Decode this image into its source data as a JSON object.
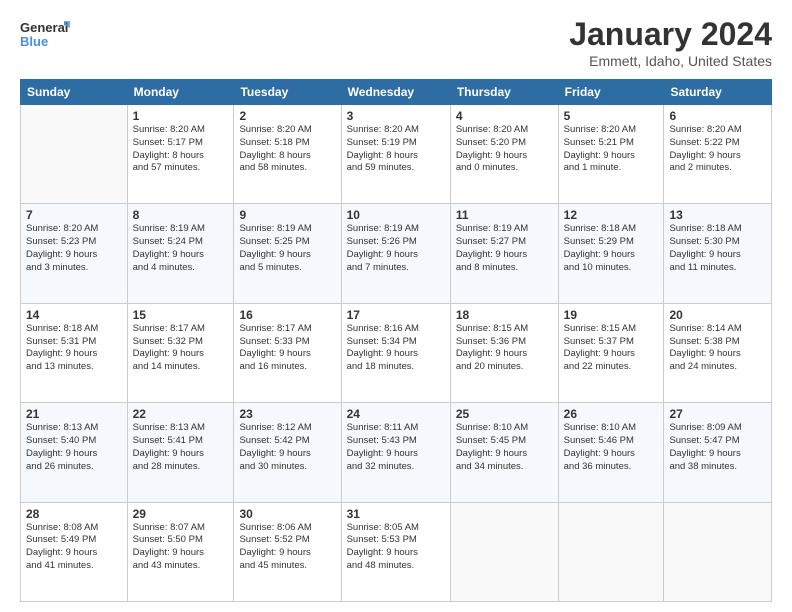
{
  "header": {
    "logo_line1": "General",
    "logo_line2": "Blue",
    "month": "January 2024",
    "location": "Emmett, Idaho, United States"
  },
  "days_of_week": [
    "Sunday",
    "Monday",
    "Tuesday",
    "Wednesday",
    "Thursday",
    "Friday",
    "Saturday"
  ],
  "weeks": [
    [
      {
        "day": "",
        "info": ""
      },
      {
        "day": "1",
        "info": "Sunrise: 8:20 AM\nSunset: 5:17 PM\nDaylight: 8 hours\nand 57 minutes."
      },
      {
        "day": "2",
        "info": "Sunrise: 8:20 AM\nSunset: 5:18 PM\nDaylight: 8 hours\nand 58 minutes."
      },
      {
        "day": "3",
        "info": "Sunrise: 8:20 AM\nSunset: 5:19 PM\nDaylight: 8 hours\nand 59 minutes."
      },
      {
        "day": "4",
        "info": "Sunrise: 8:20 AM\nSunset: 5:20 PM\nDaylight: 9 hours\nand 0 minutes."
      },
      {
        "day": "5",
        "info": "Sunrise: 8:20 AM\nSunset: 5:21 PM\nDaylight: 9 hours\nand 1 minute."
      },
      {
        "day": "6",
        "info": "Sunrise: 8:20 AM\nSunset: 5:22 PM\nDaylight: 9 hours\nand 2 minutes."
      }
    ],
    [
      {
        "day": "7",
        "info": "Sunrise: 8:20 AM\nSunset: 5:23 PM\nDaylight: 9 hours\nand 3 minutes."
      },
      {
        "day": "8",
        "info": "Sunrise: 8:19 AM\nSunset: 5:24 PM\nDaylight: 9 hours\nand 4 minutes."
      },
      {
        "day": "9",
        "info": "Sunrise: 8:19 AM\nSunset: 5:25 PM\nDaylight: 9 hours\nand 5 minutes."
      },
      {
        "day": "10",
        "info": "Sunrise: 8:19 AM\nSunset: 5:26 PM\nDaylight: 9 hours\nand 7 minutes."
      },
      {
        "day": "11",
        "info": "Sunrise: 8:19 AM\nSunset: 5:27 PM\nDaylight: 9 hours\nand 8 minutes."
      },
      {
        "day": "12",
        "info": "Sunrise: 8:18 AM\nSunset: 5:29 PM\nDaylight: 9 hours\nand 10 minutes."
      },
      {
        "day": "13",
        "info": "Sunrise: 8:18 AM\nSunset: 5:30 PM\nDaylight: 9 hours\nand 11 minutes."
      }
    ],
    [
      {
        "day": "14",
        "info": "Sunrise: 8:18 AM\nSunset: 5:31 PM\nDaylight: 9 hours\nand 13 minutes."
      },
      {
        "day": "15",
        "info": "Sunrise: 8:17 AM\nSunset: 5:32 PM\nDaylight: 9 hours\nand 14 minutes."
      },
      {
        "day": "16",
        "info": "Sunrise: 8:17 AM\nSunset: 5:33 PM\nDaylight: 9 hours\nand 16 minutes."
      },
      {
        "day": "17",
        "info": "Sunrise: 8:16 AM\nSunset: 5:34 PM\nDaylight: 9 hours\nand 18 minutes."
      },
      {
        "day": "18",
        "info": "Sunrise: 8:15 AM\nSunset: 5:36 PM\nDaylight: 9 hours\nand 20 minutes."
      },
      {
        "day": "19",
        "info": "Sunrise: 8:15 AM\nSunset: 5:37 PM\nDaylight: 9 hours\nand 22 minutes."
      },
      {
        "day": "20",
        "info": "Sunrise: 8:14 AM\nSunset: 5:38 PM\nDaylight: 9 hours\nand 24 minutes."
      }
    ],
    [
      {
        "day": "21",
        "info": "Sunrise: 8:13 AM\nSunset: 5:40 PM\nDaylight: 9 hours\nand 26 minutes."
      },
      {
        "day": "22",
        "info": "Sunrise: 8:13 AM\nSunset: 5:41 PM\nDaylight: 9 hours\nand 28 minutes."
      },
      {
        "day": "23",
        "info": "Sunrise: 8:12 AM\nSunset: 5:42 PM\nDaylight: 9 hours\nand 30 minutes."
      },
      {
        "day": "24",
        "info": "Sunrise: 8:11 AM\nSunset: 5:43 PM\nDaylight: 9 hours\nand 32 minutes."
      },
      {
        "day": "25",
        "info": "Sunrise: 8:10 AM\nSunset: 5:45 PM\nDaylight: 9 hours\nand 34 minutes."
      },
      {
        "day": "26",
        "info": "Sunrise: 8:10 AM\nSunset: 5:46 PM\nDaylight: 9 hours\nand 36 minutes."
      },
      {
        "day": "27",
        "info": "Sunrise: 8:09 AM\nSunset: 5:47 PM\nDaylight: 9 hours\nand 38 minutes."
      }
    ],
    [
      {
        "day": "28",
        "info": "Sunrise: 8:08 AM\nSunset: 5:49 PM\nDaylight: 9 hours\nand 41 minutes."
      },
      {
        "day": "29",
        "info": "Sunrise: 8:07 AM\nSunset: 5:50 PM\nDaylight: 9 hours\nand 43 minutes."
      },
      {
        "day": "30",
        "info": "Sunrise: 8:06 AM\nSunset: 5:52 PM\nDaylight: 9 hours\nand 45 minutes."
      },
      {
        "day": "31",
        "info": "Sunrise: 8:05 AM\nSunset: 5:53 PM\nDaylight: 9 hours\nand 48 minutes."
      },
      {
        "day": "",
        "info": ""
      },
      {
        "day": "",
        "info": ""
      },
      {
        "day": "",
        "info": ""
      }
    ]
  ]
}
